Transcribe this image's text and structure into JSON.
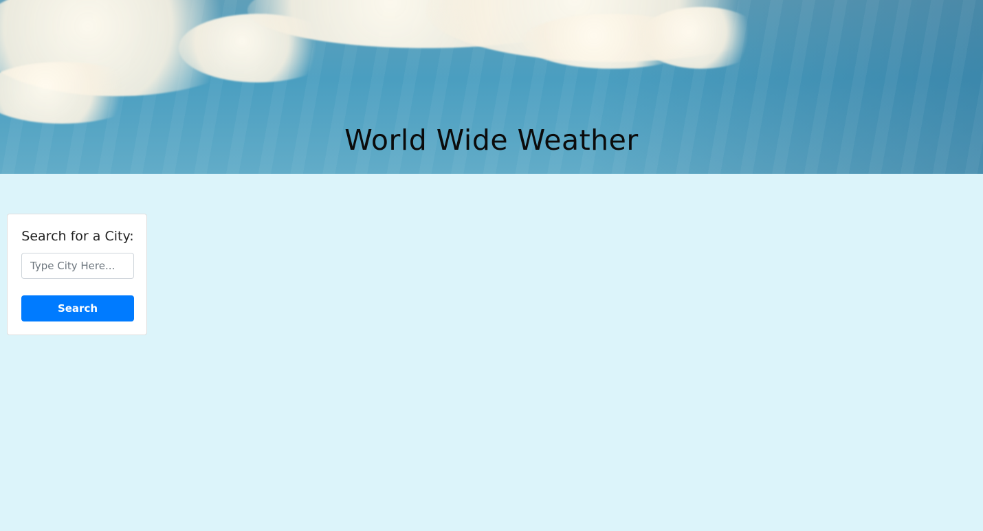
{
  "header": {
    "title": "World Wide Weather"
  },
  "search": {
    "heading": "Search for a City:",
    "placeholder": "Type City Here...",
    "value": "",
    "button_label": "Search"
  },
  "colors": {
    "background": "#dcf4fa",
    "button": "#007bff",
    "card": "#ffffff"
  }
}
